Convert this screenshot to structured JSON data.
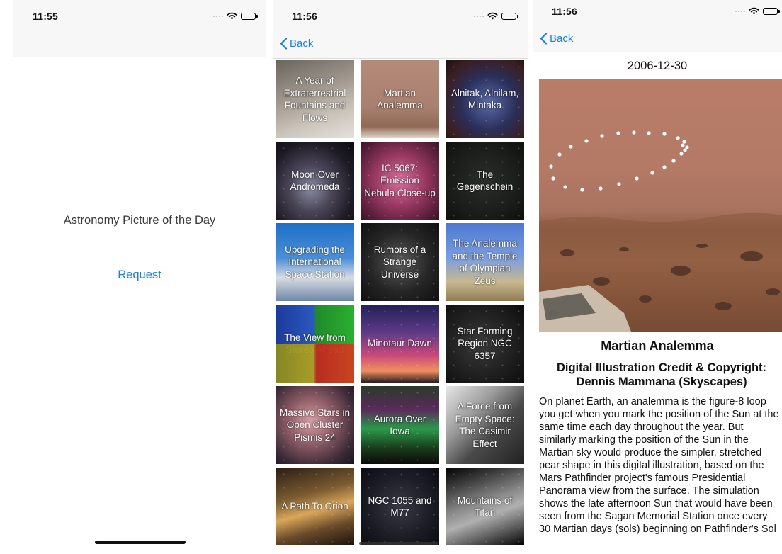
{
  "screen1": {
    "status_time": "11:55",
    "title": "Astronomy Picture of the Day",
    "request_label": "Request"
  },
  "screen2": {
    "status_time": "11:56",
    "back_label": "Back",
    "tiles": [
      {
        "label": "A Year of Extraterrestrial Fountains and Flows"
      },
      {
        "label": "Martian Analemma"
      },
      {
        "label": "Alnitak, Alnilam, Mintaka"
      },
      {
        "label": "Moon Over Andromeda"
      },
      {
        "label": "IC 5067: Emission Nebula Close-up"
      },
      {
        "label": "The Gegenschein"
      },
      {
        "label": "Upgrading the International Space Station"
      },
      {
        "label": "Rumors of a Strange Universe"
      },
      {
        "label": "The Analemma and the Temple of Olympian Zeus"
      },
      {
        "label": "The View from Stereo Ahead"
      },
      {
        "label": "Minotaur Dawn"
      },
      {
        "label": "Star Forming Region NGC 6357"
      },
      {
        "label": "Massive Stars in Open Cluster Pismis 24"
      },
      {
        "label": "Aurora Over Iowa"
      },
      {
        "label": "A Force from Empty Space: The Casimir Effect"
      },
      {
        "label": "A Path To Orion"
      },
      {
        "label": "NGC 1055 and M77"
      },
      {
        "label": "Mountains of Titan"
      }
    ]
  },
  "screen3": {
    "status_time": "11:56",
    "back_label": "Back",
    "date": "2006-12-30",
    "title": "Martian Analemma",
    "credit": "Digital Illustration Credit & Copyright: Dennis Mammana (Skyscapes)",
    "explanation": "On planet Earth, an analemma is the figure-8 loop you get when you mark the position of the Sun at the same time each day throughout the year. But similarly marking the position of the Sun in the Martian sky would produce the simpler, stretched pear shape in this digital illustration, based on the Mars Pathfinder project's famous Presidential Panorama view from the surface. The simulation shows the late afternoon Sun that would have been seen from the Sagan Memorial Station once every 30 Martian days (sols) beginning on Pathfinder's Sol"
  }
}
